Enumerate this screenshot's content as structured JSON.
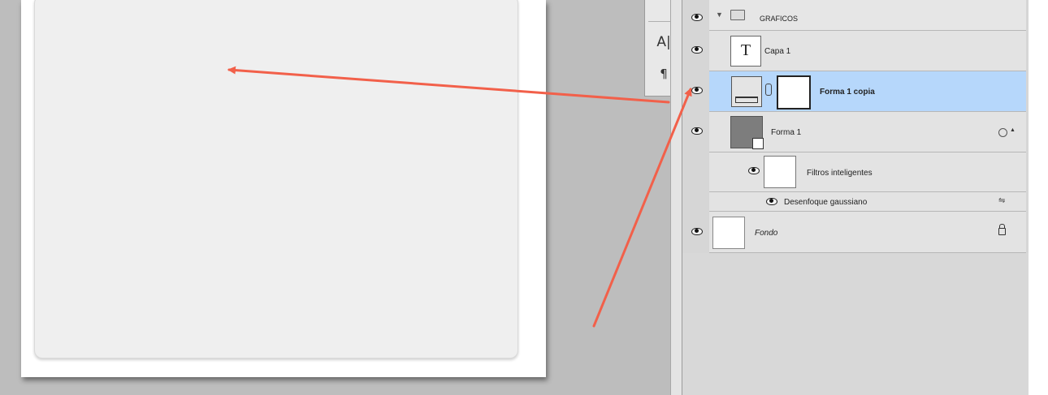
{
  "mini_panel": {
    "character_icon": "A|",
    "paragraph_icon": "¶"
  },
  "layers": {
    "group": {
      "name": "GRAFICOS",
      "icon": "folder-icon",
      "expanded": true
    },
    "rows": [
      {
        "name": "Capa 1",
        "type": "text",
        "thumb_glyph": "T"
      },
      {
        "name": "Forma 1 copia",
        "type": "shape",
        "selected": true
      },
      {
        "name": "Forma 1",
        "type": "smart-object"
      },
      {
        "name": "Filtros inteligentes",
        "type": "smart-filters"
      },
      {
        "name": "Desenfoque gaussiano",
        "type": "filter"
      },
      {
        "name": "Fondo",
        "type": "background",
        "locked": true
      }
    ]
  },
  "colors": {
    "selection": "#b6d7fb",
    "arrow": "#f2604a",
    "canvas_bg": "#bdbdbd"
  }
}
